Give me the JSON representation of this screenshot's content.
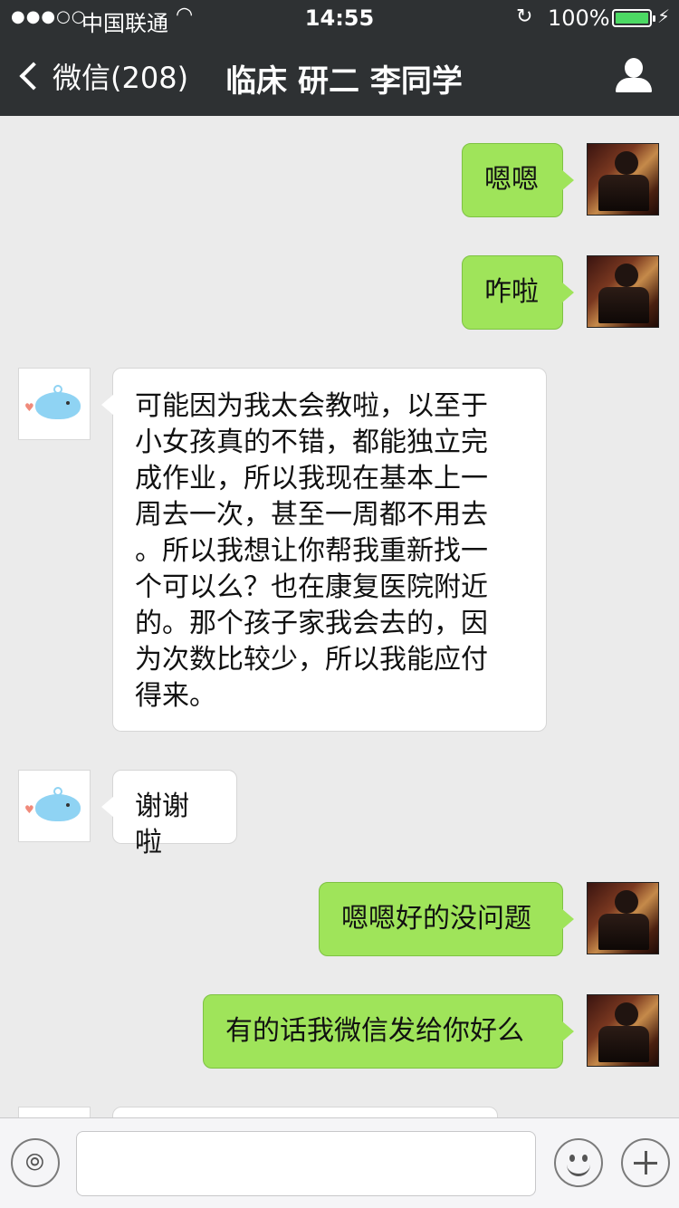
{
  "status_bar": {
    "signal": "●●●○○",
    "carrier": "中国联通",
    "time": "14:55",
    "battery_percent": "100%",
    "battery_level": 1.0
  },
  "nav": {
    "back_label": "微信(208)",
    "title": "临床 研二 李同学"
  },
  "messages": [
    {
      "from": "me",
      "text": "嗯嗯"
    },
    {
      "from": "me",
      "text": "咋啦"
    },
    {
      "from": "them",
      "text": "可能因为我太会教啦，以至于\n小女孩真的不错，都能独立完\n成作业，所以我现在基本上一\n周去一次，甚至一周都不用去\n。所以我想让你帮我重新找一\n个可以么？也在康复医院附近\n的。那个孩子家我会去的，因\n为次数比较少，所以我能应付\n得来。"
    },
    {
      "from": "them",
      "text": "谢谢啦"
    },
    {
      "from": "me",
      "text": "嗯嗯好的没问题"
    },
    {
      "from": "me",
      "text": "有的话我微信发给你好么"
    }
  ],
  "input": {
    "value": "",
    "placeholder": ""
  },
  "colors": {
    "nav_bg": "#2e3133",
    "chat_bg": "#ebebeb",
    "my_bubble": "#9fe45a",
    "their_bubble": "#ffffff",
    "battery_fill": "#4cd964"
  }
}
